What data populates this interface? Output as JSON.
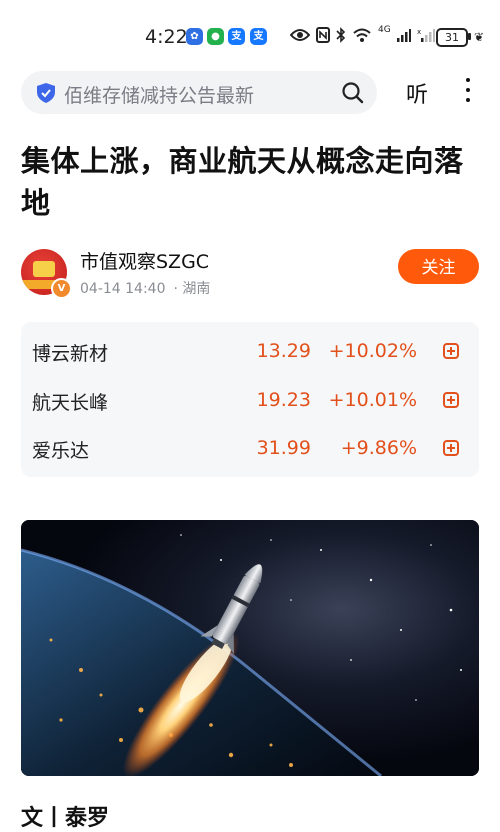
{
  "status_bar": {
    "time": "4:22",
    "battery": "31",
    "network_label": "4G",
    "notification_icons": [
      "app-icon-blue",
      "wechat-icon",
      "alipay-icon",
      "alipay-icon"
    ]
  },
  "search": {
    "placeholder": "佰维存储减持公告最新"
  },
  "actions": {
    "listen_label": "听"
  },
  "article": {
    "title": "集体上涨，商业航天从概念走向落地",
    "byline": "文丨泰罗"
  },
  "author": {
    "name": "市值观察SZGC",
    "datetime": "04-14 14:40",
    "location": "· 湖南",
    "verified_badge": "V",
    "follow_label": "关注"
  },
  "stocks": [
    {
      "name": "博云新材",
      "price": "13.29",
      "change": "+10.02%"
    },
    {
      "name": "航天长峰",
      "price": "19.23",
      "change": "+10.01%"
    },
    {
      "name": "爱乐达",
      "price": "31.99",
      "change": "+9.86%"
    }
  ],
  "colors": {
    "accent": "#ff5a0b",
    "rise": "#e2501c",
    "search_bg": "#f2f3f5",
    "card_bg": "#f6f7f9"
  }
}
